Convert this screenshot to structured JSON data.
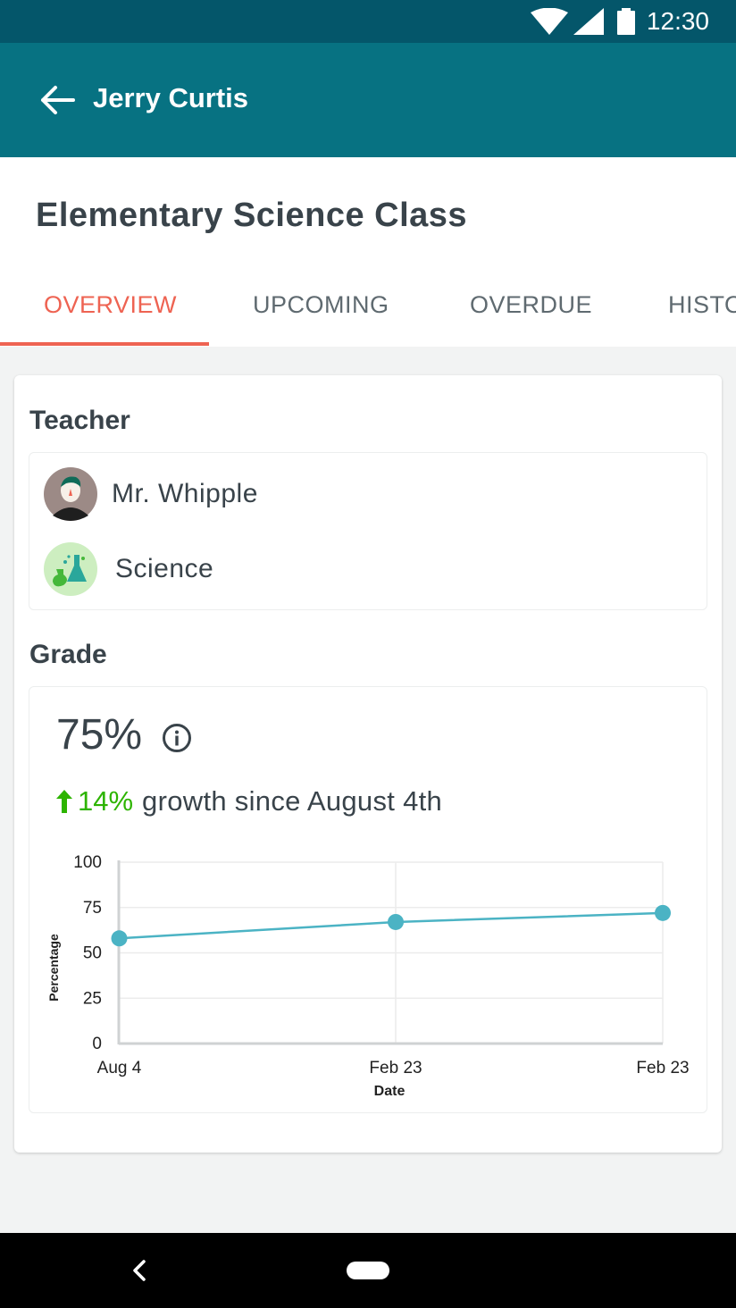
{
  "status_bar": {
    "time": "12:30",
    "icons": [
      "wifi-icon",
      "signal-icon",
      "battery-icon"
    ]
  },
  "app_bar": {
    "title": "Jerry Curtis",
    "back_icon": "arrow-left-icon"
  },
  "header": {
    "class_title": "Elementary Science Class",
    "tabs": [
      {
        "label": "OVERVIEW",
        "active": true
      },
      {
        "label": "UPCOMING",
        "active": false
      },
      {
        "label": "OVERDUE",
        "active": false
      },
      {
        "label": "HISTORY",
        "active": false
      }
    ]
  },
  "teacher": {
    "label": "Teacher",
    "name": "Mr. Whipple",
    "subject": "Science"
  },
  "grade": {
    "label": "Grade",
    "value": "75%",
    "growth_pct": "14%",
    "growth_text": "growth since August 4th"
  },
  "chart_data": {
    "type": "line",
    "x": [
      "Aug 4",
      "Feb 23",
      "Feb 23"
    ],
    "y": [
      58,
      67,
      72
    ],
    "xlabel": "Date",
    "ylabel": "Percentage",
    "ylim": [
      0,
      100
    ],
    "yticks": [
      "0",
      "25",
      "50",
      "75",
      "100"
    ],
    "grid": true,
    "legend": "none"
  },
  "colors": {
    "status_bar": "#04566a",
    "app_bar": "#077282",
    "accent_tab": "#ee6352",
    "growth_green": "#2db400",
    "series": "#4bb3c4"
  }
}
